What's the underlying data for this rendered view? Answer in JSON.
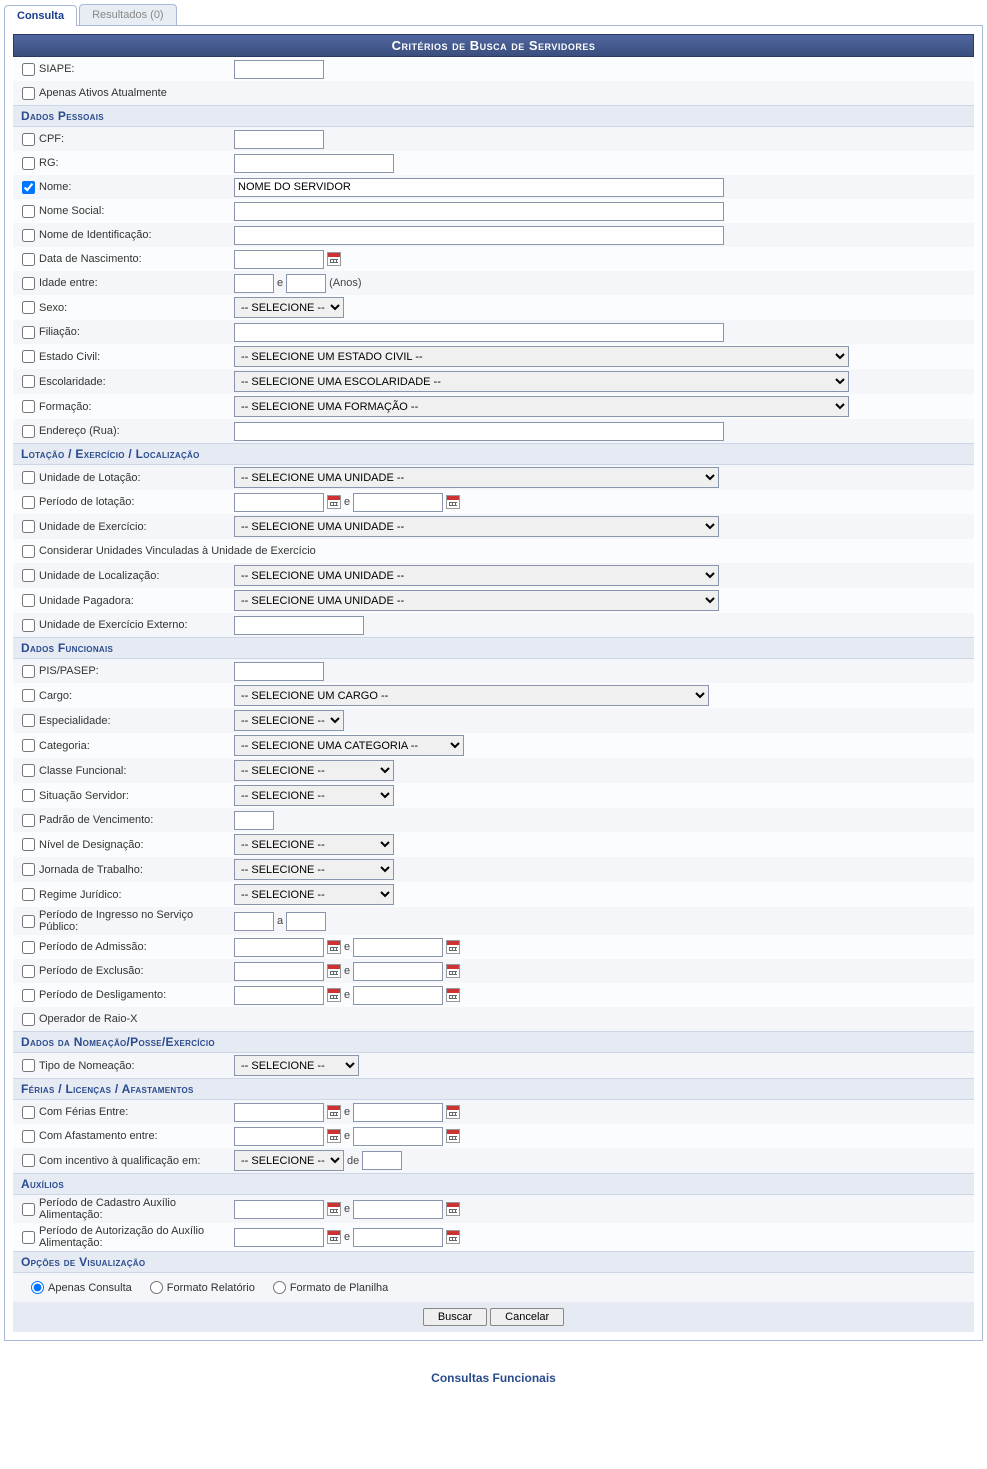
{
  "tabs": {
    "consulta": "Consulta",
    "resultados": "Resultados (0)"
  },
  "header": "Critérios de Busca de Servidores",
  "top": {
    "siape": "SIAPE:",
    "ativos": "Apenas Ativos Atualmente"
  },
  "sections": {
    "dados_pessoais": "Dados Pessoais",
    "lotacao": "Lotação / Exercício / Localização",
    "dados_funcionais": "Dados Funcionais",
    "nomeacao": "Dados da Nomeação/Posse/Exercício",
    "ferias": "Férias / Licenças / Afastamentos",
    "auxilios": "Auxílios",
    "opcoes": "Opções de Visualização"
  },
  "dp": {
    "cpf": "CPF:",
    "rg": "RG:",
    "nome": "Nome:",
    "nome_val": "NOME DO SERVIDOR",
    "nome_social": "Nome Social:",
    "nome_ident": "Nome de Identificação:",
    "data_nasc": "Data de Nascimento:",
    "idade": "Idade entre:",
    "idade_anos": "(Anos)",
    "sexo": "Sexo:",
    "filiacao": "Filiação:",
    "estado_civil": "Estado Civil:",
    "escolaridade": "Escolaridade:",
    "formacao": "Formação:",
    "endereco": "Endereço (Rua):"
  },
  "lot": {
    "unid_lotacao": "Unidade de Lotação:",
    "periodo_lotacao": "Período de lotação:",
    "unid_exercicio": "Unidade de Exercício:",
    "considerar": "Considerar Unidades Vinculadas à Unidade de Exercício",
    "unid_localizacao": "Unidade de Localização:",
    "unid_pagadora": "Unidade Pagadora:",
    "unid_ext": "Unidade de Exercício Externo:"
  },
  "df": {
    "pis": "PIS/PASEP:",
    "cargo": "Cargo:",
    "especialidade": "Especialidade:",
    "categoria": "Categoria:",
    "classe": "Classe Funcional:",
    "situacao": "Situação Servidor:",
    "padrao": "Padrão de Vencimento:",
    "nivel": "Nível de Designação:",
    "jornada": "Jornada de Trabalho:",
    "regime": "Regime Jurídico:",
    "ingresso": "Período de Ingresso no Serviço Público:",
    "admissao": "Período de Admissão:",
    "exclusao": "Período de Exclusão:",
    "desligamento": "Período de Desligamento:",
    "raiox": "Operador de Raio-X"
  },
  "nom": {
    "tipo": "Tipo de Nomeação:"
  },
  "fer": {
    "com_ferias": "Com Férias Entre:",
    "com_afast": "Com Afastamento entre:",
    "com_incentivo": "Com incentivo à qualificação em:"
  },
  "aux": {
    "cadastro": "Período de Cadastro Auxílio Alimentação:",
    "autorizacao": "Período de Autorização do Auxílio Alimentação:"
  },
  "opts": {
    "selecione": "-- SELECIONE --",
    "sel_estado_civil": "-- SELECIONE UM ESTADO CIVIL --",
    "sel_escolaridade": "-- SELECIONE UMA ESCOLARIDADE --",
    "sel_formacao": "-- SELECIONE UMA FORMAÇÃO --",
    "sel_unidade": "-- SELECIONE UMA UNIDADE --",
    "sel_cargo": "-- SELECIONE UM CARGO --",
    "sel_categoria": "-- SELECIONE UMA CATEGORIA --"
  },
  "conj": {
    "e": "e",
    "a": "a",
    "de": "de"
  },
  "viz": {
    "apenas": "Apenas Consulta",
    "relatorio": "Formato Relatório",
    "planilha": "Formato de Planilha"
  },
  "buttons": {
    "buscar": "Buscar",
    "cancelar": "Cancelar"
  },
  "footer": "Consultas Funcionais"
}
